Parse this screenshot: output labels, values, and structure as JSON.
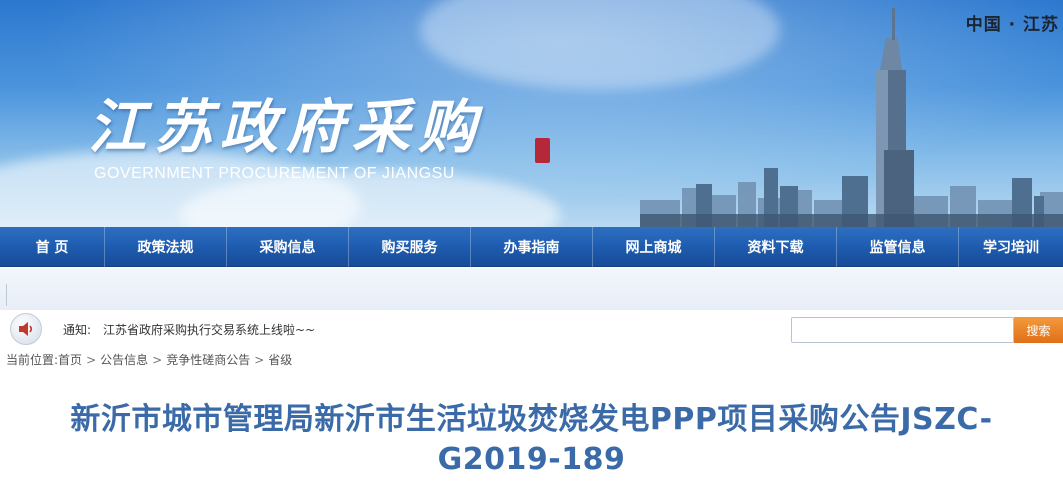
{
  "banner": {
    "region_label": "中国 · 江苏",
    "logo_cn": "江苏政府采购",
    "logo_en": "GOVERNMENT PROCUREMENT OF JIANGSU"
  },
  "nav": {
    "items": [
      {
        "label": "首 页"
      },
      {
        "label": "政策法规"
      },
      {
        "label": "采购信息"
      },
      {
        "label": "购买服务"
      },
      {
        "label": "办事指南"
      },
      {
        "label": "网上商城"
      },
      {
        "label": "资料下载"
      },
      {
        "label": "监管信息"
      },
      {
        "label": "学习培训"
      }
    ]
  },
  "notice": {
    "label": "通知:",
    "text": "江苏省政府采购执行交易系统上线啦~~"
  },
  "search": {
    "placeholder": "",
    "value": "",
    "button_label": "搜索"
  },
  "breadcrumb": {
    "prefix": "当前位置:",
    "items": [
      {
        "label": "首页"
      },
      {
        "label": "公告信息"
      },
      {
        "label": "竞争性磋商公告"
      },
      {
        "label": "省级"
      }
    ],
    "separator": ">"
  },
  "article": {
    "title": "新沂市城市管理局新沂市生活垃圾焚烧发电PPP项目采购公告JSZC-G2019-189"
  },
  "colors": {
    "nav_bg": "#1d5aad",
    "title_text": "#3a6aa8",
    "search_button": "#e0701a",
    "seal": "#b5283a"
  }
}
